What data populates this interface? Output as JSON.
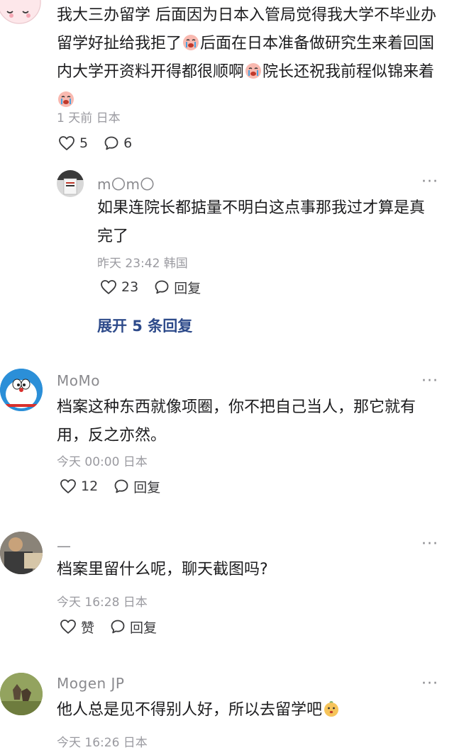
{
  "comments": [
    {
      "text_segments": [
        "我大三办留学 后面因为日本入管局觉得我大学不毕业办留学好扯给我拒了",
        "后面在日本准备做研究生来着回国内大学开资料开得都很顺啊",
        "院长还祝我前程似锦来着",
        ""
      ],
      "meta": "1 天前 日本",
      "likes": "5",
      "replies": "6"
    },
    {
      "username": "m〇m〇",
      "text": "如果连院长都掂量不明白这点事那我过才算是真完了",
      "meta": "昨天 23:42 韩国",
      "likes": "23",
      "reply_label": "回复",
      "expand_label": "展开 5 条回复"
    },
    {
      "username": "MoMo",
      "text": "档案这种东西就像项圈，你不把自己当人，那它就有用，反之亦然。",
      "meta": "今天 00:00 日本",
      "likes": "12",
      "reply_label": "回复"
    },
    {
      "username": "—",
      "text": "档案里留什么呢，聊天截图吗?",
      "meta": "今天 16:28 日本",
      "likes": "赞",
      "reply_label": "回复"
    },
    {
      "username": "Mogen JP",
      "text": "他人总是见不得别人好，所以去留学吧",
      "meta": "今天 16:26 日本"
    }
  ],
  "more_label": "···",
  "icons": {
    "like": "heart-outline-icon",
    "comment": "speech-bubble-icon",
    "more": "more-dots-icon",
    "emoji_crying": "crying-face-emoji",
    "emoji_pout": "pouting-face-emoji"
  },
  "colors": {
    "text": "#1c1c1e",
    "secondary": "#8a8a8e",
    "link": "#2d4a8a"
  }
}
